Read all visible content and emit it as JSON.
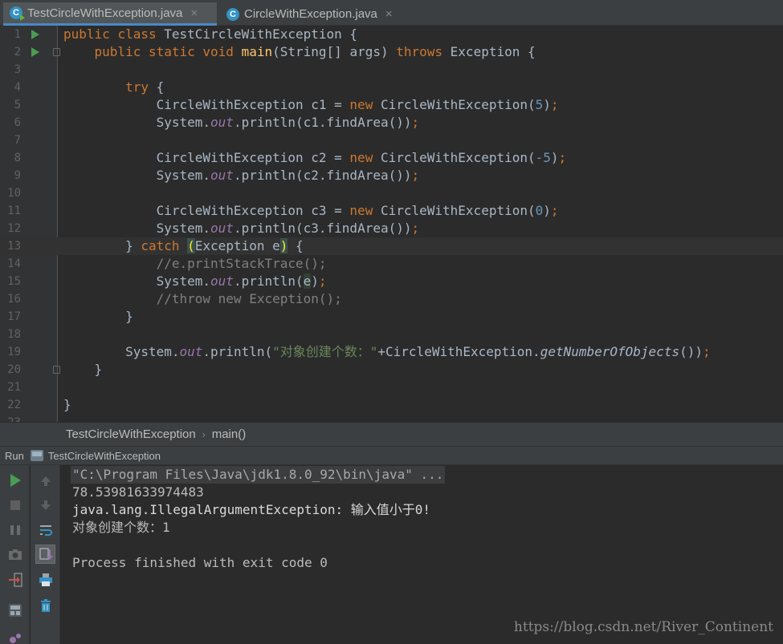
{
  "tabs": [
    {
      "label": "TestCircleWithException.java",
      "icon": "java-class-icon",
      "close": "×"
    },
    {
      "label": "CircleWithException.java",
      "icon": "java-class-icon",
      "close": "×"
    }
  ],
  "breadcrumb": {
    "class_name": "TestCircleWithException",
    "separator": "›",
    "method": "main()"
  },
  "run_panel": {
    "title": "Run",
    "config": "TestCircleWithException"
  },
  "console": {
    "lines": [
      "\"C:\\Program Files\\Java\\jdk1.8.0_92\\bin\\java\" ...",
      "78.53981633974483",
      "java.lang.IllegalArgumentException: 输入值小于0!",
      "对象创建个数：1",
      "",
      "Process finished with exit code 0"
    ]
  },
  "watermark": "https://blog.csdn.net/River_Continent",
  "code": {
    "l1": [
      "public",
      " ",
      "class",
      " TestCircleWithException {"
    ],
    "l2": [
      "public",
      " ",
      "static",
      " ",
      "void",
      " ",
      "main",
      "(String[] args) ",
      "throws",
      " Exception {"
    ],
    "l4": [
      "try",
      " {"
    ],
    "l5": [
      "CircleWithException c1 = ",
      "new",
      " CircleWithException(",
      "5",
      ")",
      ";"
    ],
    "l6": [
      "System.",
      "out",
      ".println(c1.findArea())",
      ";"
    ],
    "l8": [
      "CircleWithException c2 = ",
      "new",
      " CircleWithException(",
      "-5",
      ")",
      ";"
    ],
    "l9": [
      "System.",
      "out",
      ".println(c2.findArea())",
      ";"
    ],
    "l11": [
      "CircleWithException c3 = ",
      "new",
      " CircleWithException(",
      "0",
      ")",
      ";"
    ],
    "l12": [
      "System.",
      "out",
      ".println(c3.findArea())",
      ";"
    ],
    "l13": [
      "} ",
      "catch",
      " ",
      "(",
      "Exception e",
      ")",
      " {"
    ],
    "l14": [
      "//e.printStackTrace();"
    ],
    "l15": [
      "System.",
      "out",
      ".println(",
      "e",
      ")",
      ";"
    ],
    "l16": [
      "//throw new Exception();"
    ],
    "l17": [
      "}"
    ],
    "l19": [
      "System.",
      "out",
      ".println(",
      "\"对象创建个数：\"",
      "+CircleWithException.",
      "getNumberOfObjects",
      "())",
      ";"
    ],
    "l20": [
      "}"
    ],
    "l22": [
      "}"
    ]
  },
  "colors": {
    "keyword": "#cc7832",
    "method": "#ffc66d",
    "number": "#6897bb",
    "field": "#9876aa",
    "string": "#6a8759",
    "comment": "#808080",
    "run_green": "#499c54"
  }
}
